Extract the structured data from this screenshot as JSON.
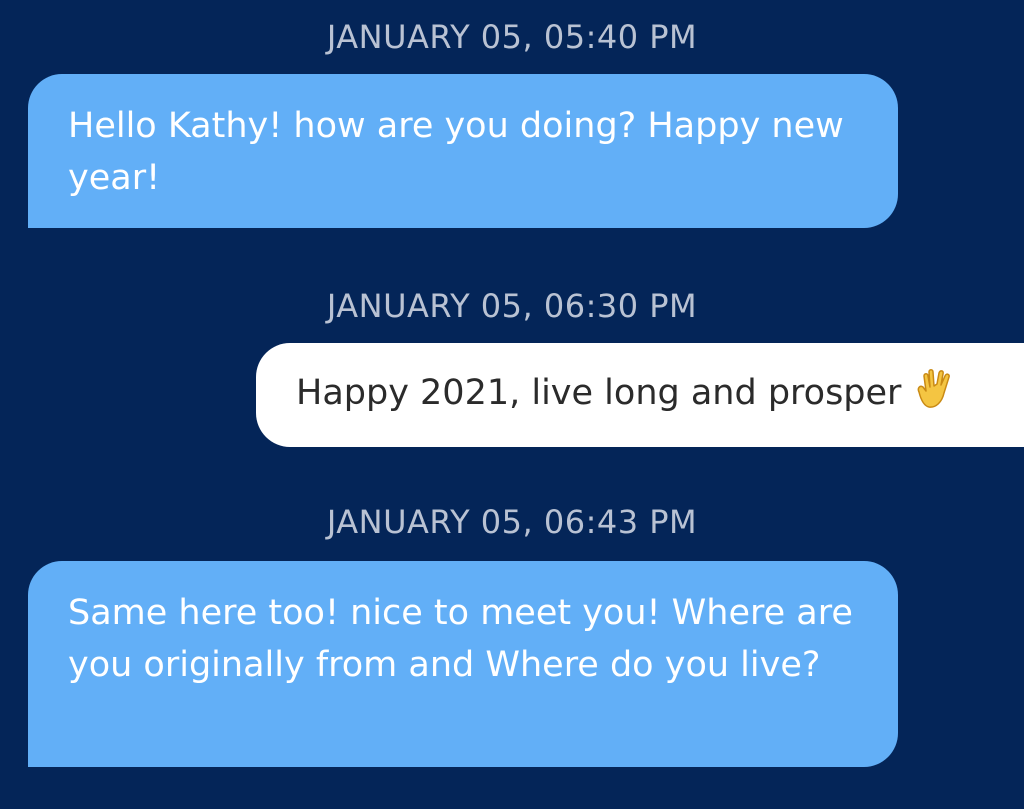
{
  "messages": [
    {
      "timestamp": "JANUARY 05, 05:40 PM",
      "direction": "incoming",
      "text": "Hello Kathy! how are you doing? Happy new year!"
    },
    {
      "timestamp": "JANUARY 05, 06:30 PM",
      "direction": "outgoing",
      "text": "Happy 2021, live long and prosper",
      "emoji": "vulcan-salute-icon"
    },
    {
      "timestamp": "JANUARY 05, 06:43 PM",
      "direction": "incoming",
      "text": "Same here too! nice to meet you! Where are you originally from and Where do you live?"
    }
  ],
  "colors": {
    "background": "#042558",
    "incoming_bubble": "#62aff7",
    "outgoing_bubble": "#ffffff",
    "timestamp_text": "#b9c2d3"
  }
}
